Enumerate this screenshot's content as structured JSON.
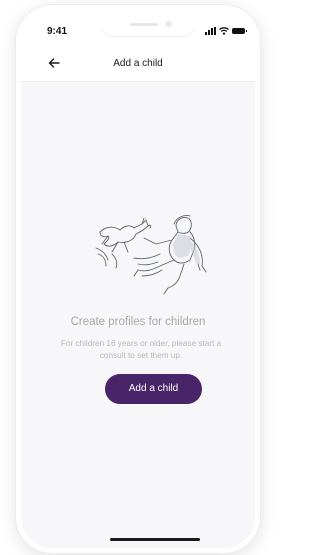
{
  "status_bar": {
    "time": "9:41",
    "icons": [
      "signal-icon",
      "wifi-icon",
      "battery-icon"
    ]
  },
  "nav": {
    "back_icon": "arrow-left-icon",
    "title": "Add a child"
  },
  "empty_state": {
    "illustration": "person-and-dog-illustration",
    "title": "Create profiles for children",
    "description": "For children 16 years or older, please start a consult to set them up.",
    "button_label": "Add a child"
  },
  "colors": {
    "accent": "#4a2469",
    "background": "#f7f7f9",
    "muted_text": "#a7a7ad"
  }
}
